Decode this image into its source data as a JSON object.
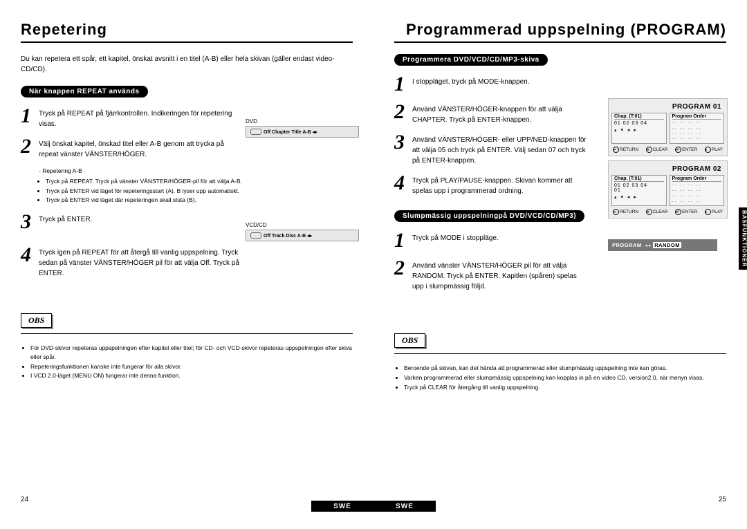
{
  "left": {
    "title": "Repetering",
    "intro": "Du kan repetera ett spår, ett kapitel, önskat avsnitt i en titel (A-B) eller hela skivan (gäller endast video-CD/CD).",
    "pill": "När knappen REPEAT används",
    "steps": [
      {
        "num": "1",
        "text": "Tryck på REPEAT på fjärrkontrollen. Indikeringen för repetering visas."
      },
      {
        "num": "2",
        "text": "Välj önskat kapitel, önskad titel eller  A-B genom att trycka på repeat vänster VÄNSTER/HÖGER."
      },
      {
        "num": "3",
        "text": "Tryck på ENTER."
      },
      {
        "num": "4",
        "text": "Tryck igen på REPEAT för att återgå till vanlig uppspelning. Tryck sedan på vänster VÄNSTER/HÖGER pil för att välja Off. Tryck på ENTER."
      }
    ],
    "sublist_title": "- Repetering A-B",
    "sublist": [
      "Tryck på REPEAT. Tryck på vänster VÄNSTER/HÖGER-pil för att välja A-B.",
      "Tryck på ENTER vid läget för repeteringsstart (A). B lyser upp automatiskt.",
      "Tryck på ENTER vid läget där repeteringen skall sluta (B)."
    ],
    "obs": "OBS",
    "notes": [
      "För DVD-skivor repeteras uppspelningen efter kapitel eller titel; för CD- och VCD-skivor repeteras uppspelningen efter skiva eller spår.",
      "Repeteringsfunktionen kanske inte fungerar för alla skivor.",
      "I VCD 2.0-läget (MENU ON) fungerar inte denna funktion."
    ],
    "osd_dvd_label": "DVD",
    "osd_dvd": "Off   Chapter   Title   A-B  ◂▸",
    "osd_vcd_label": "VCD/CD",
    "osd_vcd": "Off   Track   Disc   A-B  ◂▸",
    "page_no": "24",
    "swe": "SWE"
  },
  "right": {
    "title": "Programmerad uppspelning (PROGRAM)",
    "pill1": "Programmera DVD/VCD/CD/MP3-skiva",
    "steps1": [
      {
        "num": "1",
        "text": "I stoppläget, tryck på MODE-knappen."
      },
      {
        "num": "2",
        "text": "Använd VÄNSTER/HÖGER-knappen för att välja CHAPTER. Tryck på ENTER-knappen."
      },
      {
        "num": "3",
        "text": "Använd VÄNSTER/HÖGER- eller UPP/NED-knappen för att välja 05 och tryck på ENTER. Välj sedan 07 och tryck på ENTER-knappen."
      },
      {
        "num": "4",
        "text": "Tryck på PLAY/PAUSE-knappen. Skivan kommer att spelas upp i programmerad ordning."
      }
    ],
    "pill2": "Slumpmässig uppspelningpå DVD/VCD/CD/MP3)",
    "steps2": [
      {
        "num": "1",
        "text": "Tryck på MODE i stoppläge."
      },
      {
        "num": "2",
        "text": "Använd vänster VÄNSTER/HÖGER pil för att välja RANDOM. Tryck på ENTER. Kapitlen (spåren) spelas upp i slumpmässig följd."
      }
    ],
    "obs": "OBS",
    "notes": [
      "Beroende på skivan, kan det hända att programmerad eller slumpmässig uppspelning inte kan göras.",
      "Varken programmerad eller slumpmässig uppspelning kan kopplas in på en video CD, version2.0, när menyn visas.",
      "Tryck på CLEAR för återgång till vanlig uppspelning."
    ],
    "osd": {
      "p1_title": "PROGRAM 01",
      "p2_title": "PROGRAM 02",
      "col1_header": "Chap.  (T:01)",
      "col2_header": "Program Order",
      "row1": "01  02  03  04",
      "row2": "01",
      "arrows": "▴ ▾ ◂ ▸",
      "dashes": "--  --  --  --\n--  --  --  --\n--  --  --  --\n--  --  --  --",
      "legend_return": "RETURN",
      "legend_clear": "CLEAR",
      "legend_enter": "ENTER",
      "legend_play": "PLAY"
    },
    "random_program": "PROGRAM",
    "random_random": "RANDOM",
    "page_no": "25",
    "swe": "SWE",
    "side_label": "BASFUNKTIONER"
  }
}
